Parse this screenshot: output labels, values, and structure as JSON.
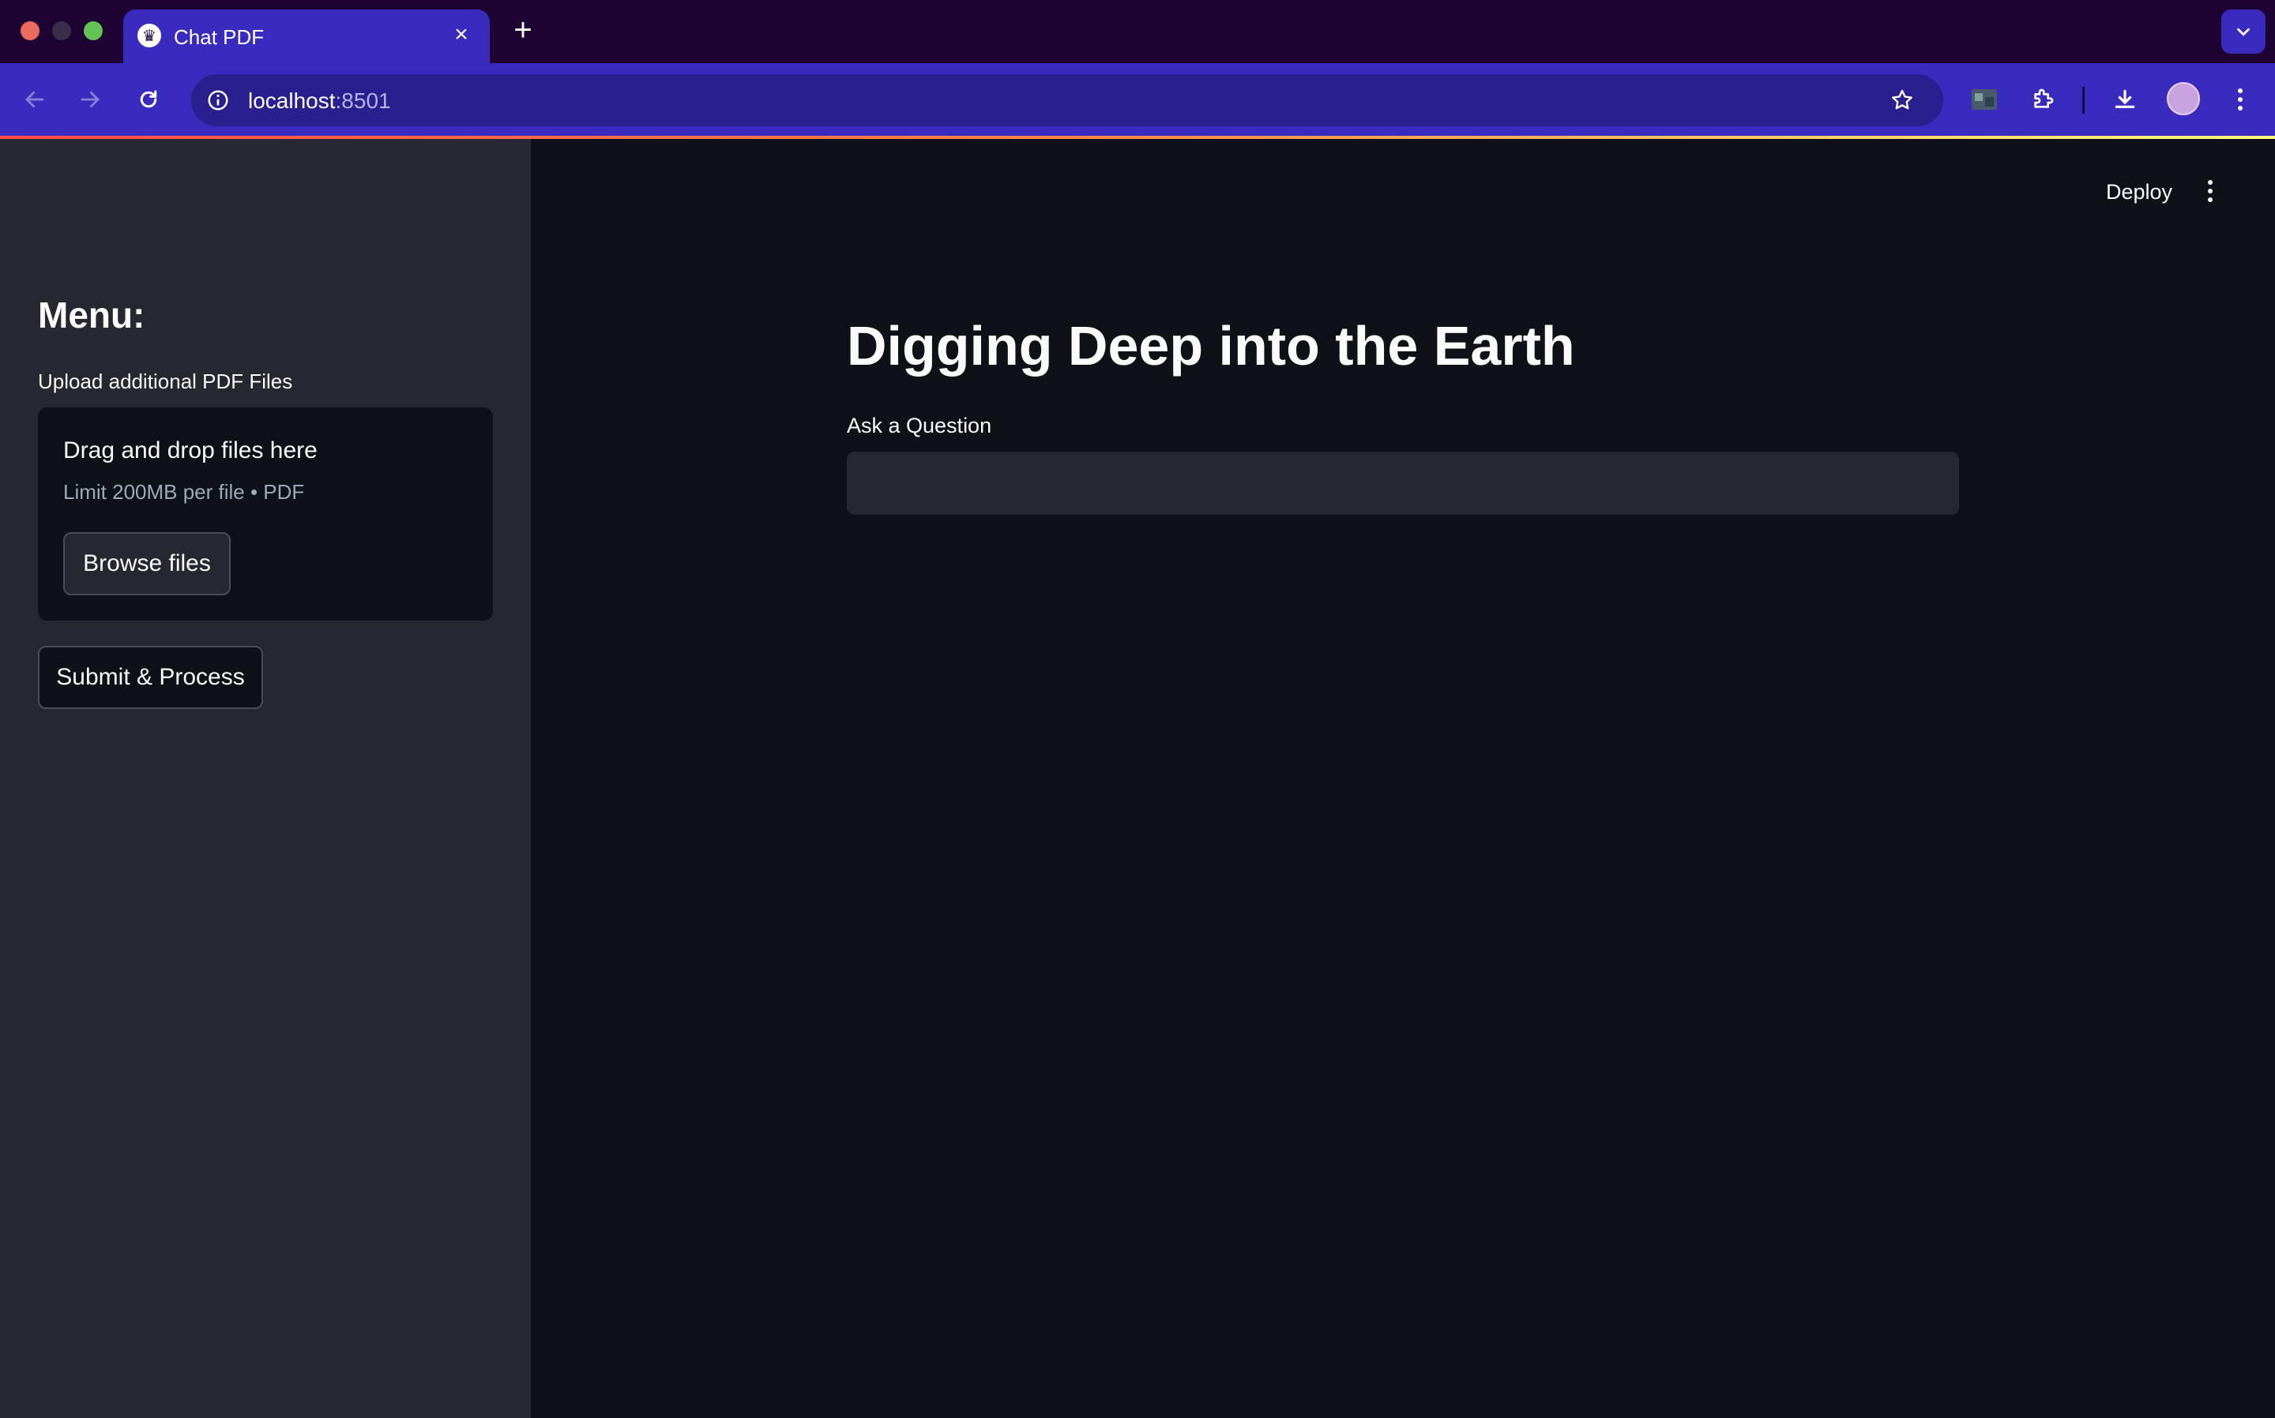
{
  "browser": {
    "tab_title": "Chat PDF",
    "url_host": "localhost",
    "url_port": ":8501"
  },
  "sidebar": {
    "heading": "Menu:",
    "uploader_label": "Upload additional PDF Files",
    "dropzone_title": "Drag and drop files here",
    "dropzone_limit": "Limit 200MB per file • PDF",
    "browse_label": "Browse files",
    "submit_label": "Submit & Process"
  },
  "header": {
    "deploy_label": "Deploy"
  },
  "main": {
    "title": "Digging Deep into the Earth",
    "question_label": "Ask a Question",
    "question_value": ""
  },
  "colors": {
    "tabbar_bg": "#1e0433",
    "toolbar_bg": "#3a2bbf",
    "sidebar_bg": "#262730",
    "main_bg": "#0e1117",
    "text": "#fafafa"
  }
}
